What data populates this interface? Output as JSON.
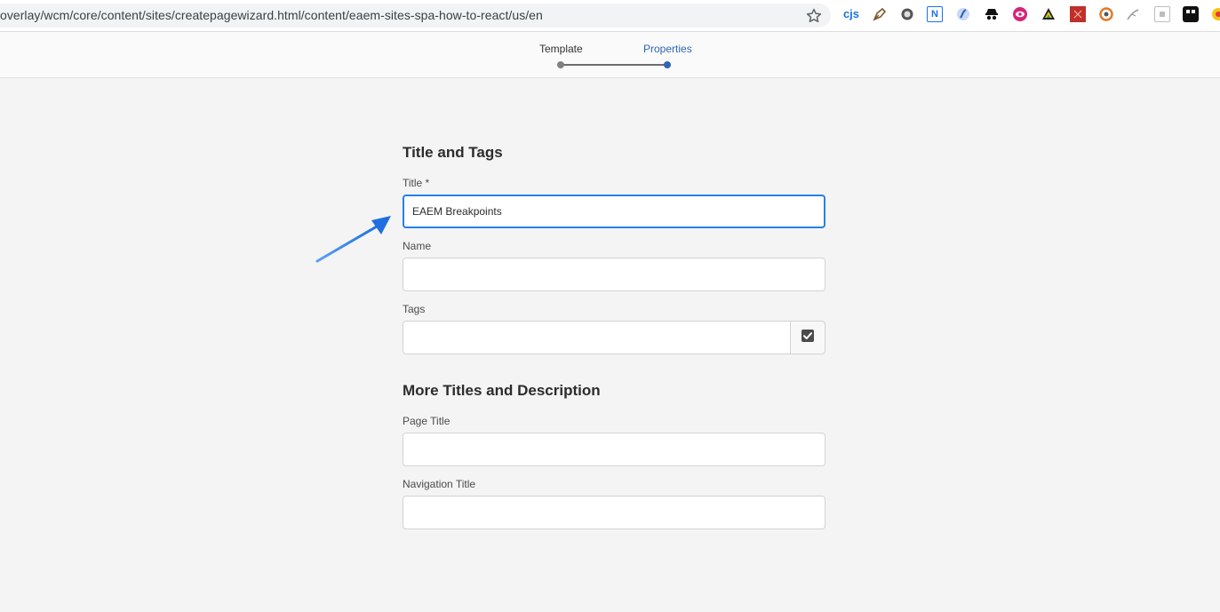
{
  "browser": {
    "url": "overlay/wcm/core/content/sites/createpagewizard.html/content/eaem-sites-spa-how-to-react/us/en",
    "bookmark_icon": "star-icon",
    "extensions": [
      "cjs",
      "pen-nib",
      "circle",
      "N",
      "swirl",
      "spy",
      "eye",
      "triangle",
      "red-square",
      "ring",
      "feather",
      "box",
      "dark-square"
    ]
  },
  "wizard": {
    "steps": [
      {
        "label": "Template",
        "state": "done"
      },
      {
        "label": "Properties",
        "state": "current"
      }
    ],
    "colors": {
      "active": "#2d66b5",
      "done": "#808080"
    }
  },
  "form": {
    "section1": {
      "heading": "Title and Tags",
      "title_label": "Title *",
      "title_value": "EAEM Breakpoints",
      "name_label": "Name",
      "name_value": "",
      "tags_label": "Tags",
      "tags_value": "",
      "tags_button_icon": "checkbox-icon"
    },
    "section2": {
      "heading": "More Titles and Description",
      "page_title_label": "Page Title",
      "page_title_value": "",
      "nav_title_label": "Navigation Title",
      "nav_title_value": ""
    }
  },
  "annotation": {
    "icon": "arrow-icon",
    "color": "#2f7be6"
  }
}
